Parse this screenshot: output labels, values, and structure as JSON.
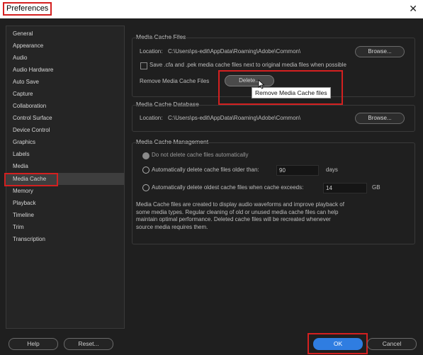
{
  "window": {
    "title": "Preferences",
    "close_icon": "close-icon"
  },
  "sidebar": {
    "items": [
      "General",
      "Appearance",
      "Audio",
      "Audio Hardware",
      "Auto Save",
      "Capture",
      "Collaboration",
      "Control Surface",
      "Device Control",
      "Graphics",
      "Labels",
      "Media",
      "Media Cache",
      "Memory",
      "Playback",
      "Timeline",
      "Trim",
      "Transcription"
    ],
    "selected": "Media Cache"
  },
  "files": {
    "title": "Media Cache Files",
    "location_label": "Location:",
    "location_value": "C:\\Users\\ps-edit\\AppData\\Roaming\\Adobe\\Common\\",
    "browse_label": "Browse...",
    "save_checkbox_label": "Save .cfa and .pek media cache files next to original media files when possible",
    "remove_label": "Remove Media Cache Files",
    "delete_label": "Delete...",
    "tooltip": "Remove Media Cache files"
  },
  "database": {
    "title": "Media Cache Database",
    "location_label": "Location:",
    "location_value": "C:\\Users\\ps-edit\\AppData\\Roaming\\Adobe\\Common\\",
    "browse_label": "Browse..."
  },
  "management": {
    "title": "Media Cache Management",
    "opt1": "Do not delete cache files automatically",
    "opt2": "Automatically delete cache files older than:",
    "opt2_value": "90",
    "opt2_unit": "days",
    "opt3": "Automatically delete oldest cache files when cache exceeds:",
    "opt3_value": "14",
    "opt3_unit": "GB",
    "description": "Media Cache files are created to display audio waveforms and improve playback of\nsome media types.  Regular cleaning of old or unused media cache files can help\nmaintain optimal performance. Deleted cache files will be recreated whenever\nsource media requires them."
  },
  "footer": {
    "help_label": "Help",
    "reset_label": "Reset...",
    "ok_label": "OK",
    "cancel_label": "Cancel"
  },
  "colors": {
    "accent": "#2f7de1",
    "highlight": "#d42020",
    "background": "#1f1f1f"
  }
}
